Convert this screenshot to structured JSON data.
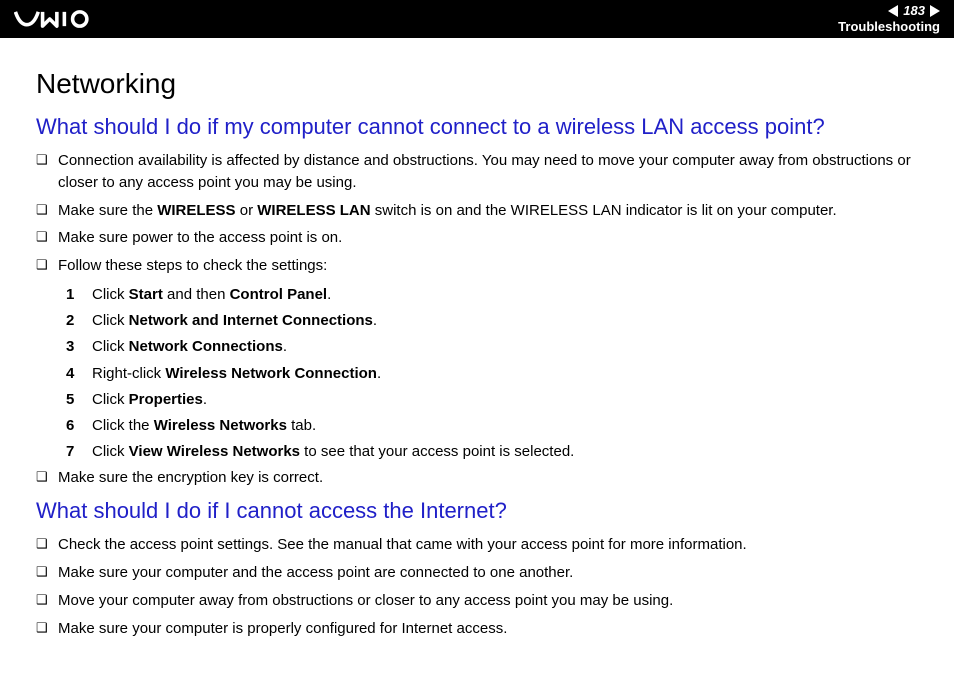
{
  "header": {
    "page_number": "183",
    "section": "Troubleshooting"
  },
  "main": {
    "title": "Networking",
    "q1": {
      "heading": "What should I do if my computer cannot connect to a wireless LAN access point?",
      "b1": "Connection availability is affected by distance and obstructions. You may need to move your computer away from obstructions or closer to any access point you may be using.",
      "b2_pre": "Make sure the ",
      "b2_bold1": "WIRELESS",
      "b2_mid": " or ",
      "b2_bold2": "WIRELESS LAN",
      "b2_post": " switch is on and the WIRELESS LAN indicator is lit on your computer.",
      "b3": "Make sure power to the access point is on.",
      "b4": "Follow these steps to check the settings:",
      "steps": {
        "s1_pre": "Click ",
        "s1_b1": "Start",
        "s1_mid": " and then ",
        "s1_b2": "Control Panel",
        "s1_post": ".",
        "s2_pre": "Click ",
        "s2_b1": "Network and Internet Connections",
        "s2_post": ".",
        "s3_pre": "Click ",
        "s3_b1": "Network Connections",
        "s3_post": ".",
        "s4_pre": "Right-click ",
        "s4_b1": "Wireless Network Connection",
        "s4_post": ".",
        "s5_pre": "Click ",
        "s5_b1": "Properties",
        "s5_post": ".",
        "s6_pre": "Click the ",
        "s6_b1": "Wireless Networks",
        "s6_post": " tab.",
        "s7_pre": "Click ",
        "s7_b1": "View Wireless Networks",
        "s7_post": " to see that your access point is selected."
      },
      "b5": "Make sure the encryption key is correct."
    },
    "q2": {
      "heading": "What should I do if I cannot access the Internet?",
      "b1": "Check the access point settings. See the manual that came with your access point for more information.",
      "b2": "Make sure your computer and the access point are connected to one another.",
      "b3": "Move your computer away from obstructions or closer to any access point you may be using.",
      "b4": "Make sure your computer is properly configured for Internet access."
    }
  }
}
